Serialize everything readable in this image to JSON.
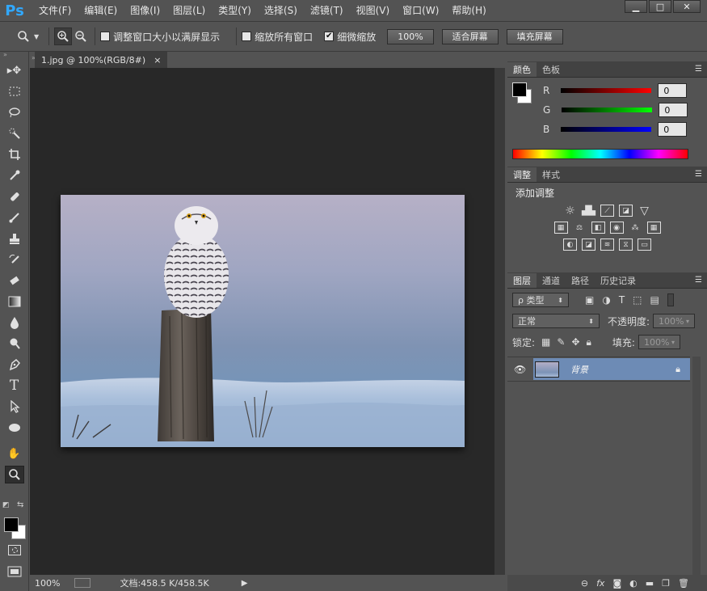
{
  "app": {
    "logo": "Ps"
  },
  "menu": [
    "文件(F)",
    "编辑(E)",
    "图像(I)",
    "图层(L)",
    "类型(Y)",
    "选择(S)",
    "滤镜(T)",
    "视图(V)",
    "窗口(W)",
    "帮助(H)"
  ],
  "window_controls": {
    "minimize": "▁",
    "maximize": "□",
    "close": "✕"
  },
  "options": {
    "resize_windows": "调整窗口大小以满屏显示",
    "zoom_all": "缩放所有窗口",
    "scrubby_zoom": "细微缩放",
    "btn_100": "100%",
    "btn_fit": "适合屏幕",
    "btn_fill": "填充屏幕"
  },
  "document": {
    "tab_title": "1.jpg @ 100%(RGB/8#)",
    "tab_close": "×",
    "zoom": "100%",
    "doc_info": "文档:458.5 K/458.5K"
  },
  "color_panel": {
    "tabs": [
      "颜色",
      "色板"
    ],
    "r_label": "R",
    "g_label": "G",
    "b_label": "B",
    "r": "0",
    "g": "0",
    "b": "0"
  },
  "adjust_panel": {
    "tabs": [
      "调整",
      "样式"
    ],
    "title": "添加调整"
  },
  "layers_panel": {
    "tabs": [
      "图层",
      "通道",
      "路径",
      "历史记录"
    ],
    "filter_kind": "ρ 类型",
    "blend_mode": "正常",
    "opacity_label": "不透明度:",
    "opacity_value": "100%",
    "lock_label": "锁定:",
    "fill_label": "填充:",
    "fill_value": "100%",
    "layer_name": "背景"
  },
  "colors": {
    "accent": "#31a8ff",
    "layer_selected": "#6d8bb5"
  }
}
